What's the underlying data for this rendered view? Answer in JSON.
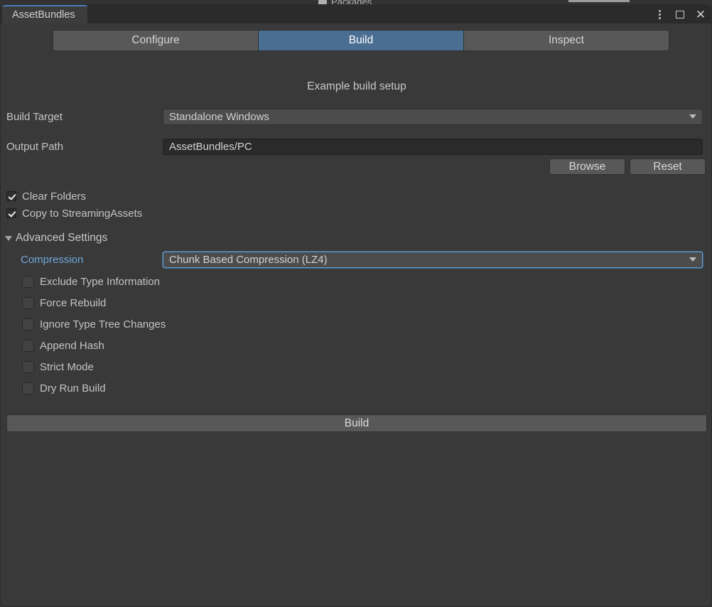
{
  "background": {
    "peek_tab_label": "Packages"
  },
  "window": {
    "tab_title": "AssetBundles",
    "controls": {
      "menu_label": "⋮",
      "restore_label": "Restore",
      "close_label": "✕"
    }
  },
  "mode_tabs": [
    {
      "label": "Configure",
      "active": false
    },
    {
      "label": "Build",
      "active": true
    },
    {
      "label": "Inspect",
      "active": false
    }
  ],
  "caption": "Example build setup",
  "fields": {
    "build_target": {
      "label": "Build Target",
      "value": "Standalone Windows",
      "type": "popup"
    },
    "output_path": {
      "label": "Output Path",
      "value": "AssetBundles/PC",
      "type": "textfield"
    }
  },
  "path_buttons": [
    {
      "label": "Browse"
    },
    {
      "label": "Reset"
    }
  ],
  "top_toggles": [
    {
      "label": "Clear Folders",
      "checked": true
    },
    {
      "label": "Copy to StreamingAssets",
      "checked": true
    }
  ],
  "foldout": {
    "label": "Advanced Settings",
    "expanded": true
  },
  "compression": {
    "label": "Compression",
    "value": "Chunk Based Compression (LZ4)",
    "focused": true
  },
  "advanced_toggles": [
    {
      "label": "Exclude Type Information",
      "checked": false
    },
    {
      "label": "Force Rebuild",
      "checked": false
    },
    {
      "label": "Ignore Type Tree Changes",
      "checked": false
    },
    {
      "label": "Append Hash",
      "checked": false
    },
    {
      "label": "Strict Mode",
      "checked": false
    },
    {
      "label": "Dry Run Build",
      "checked": false
    }
  ],
  "build_button": {
    "label": "Build"
  },
  "colors": {
    "accent_blue": "#6fa8dc",
    "tab_active": "#4a6d92",
    "focus_border": "#5a9bd5",
    "panel_bg": "#393939",
    "titlebar_bg": "#2b2b2b"
  }
}
